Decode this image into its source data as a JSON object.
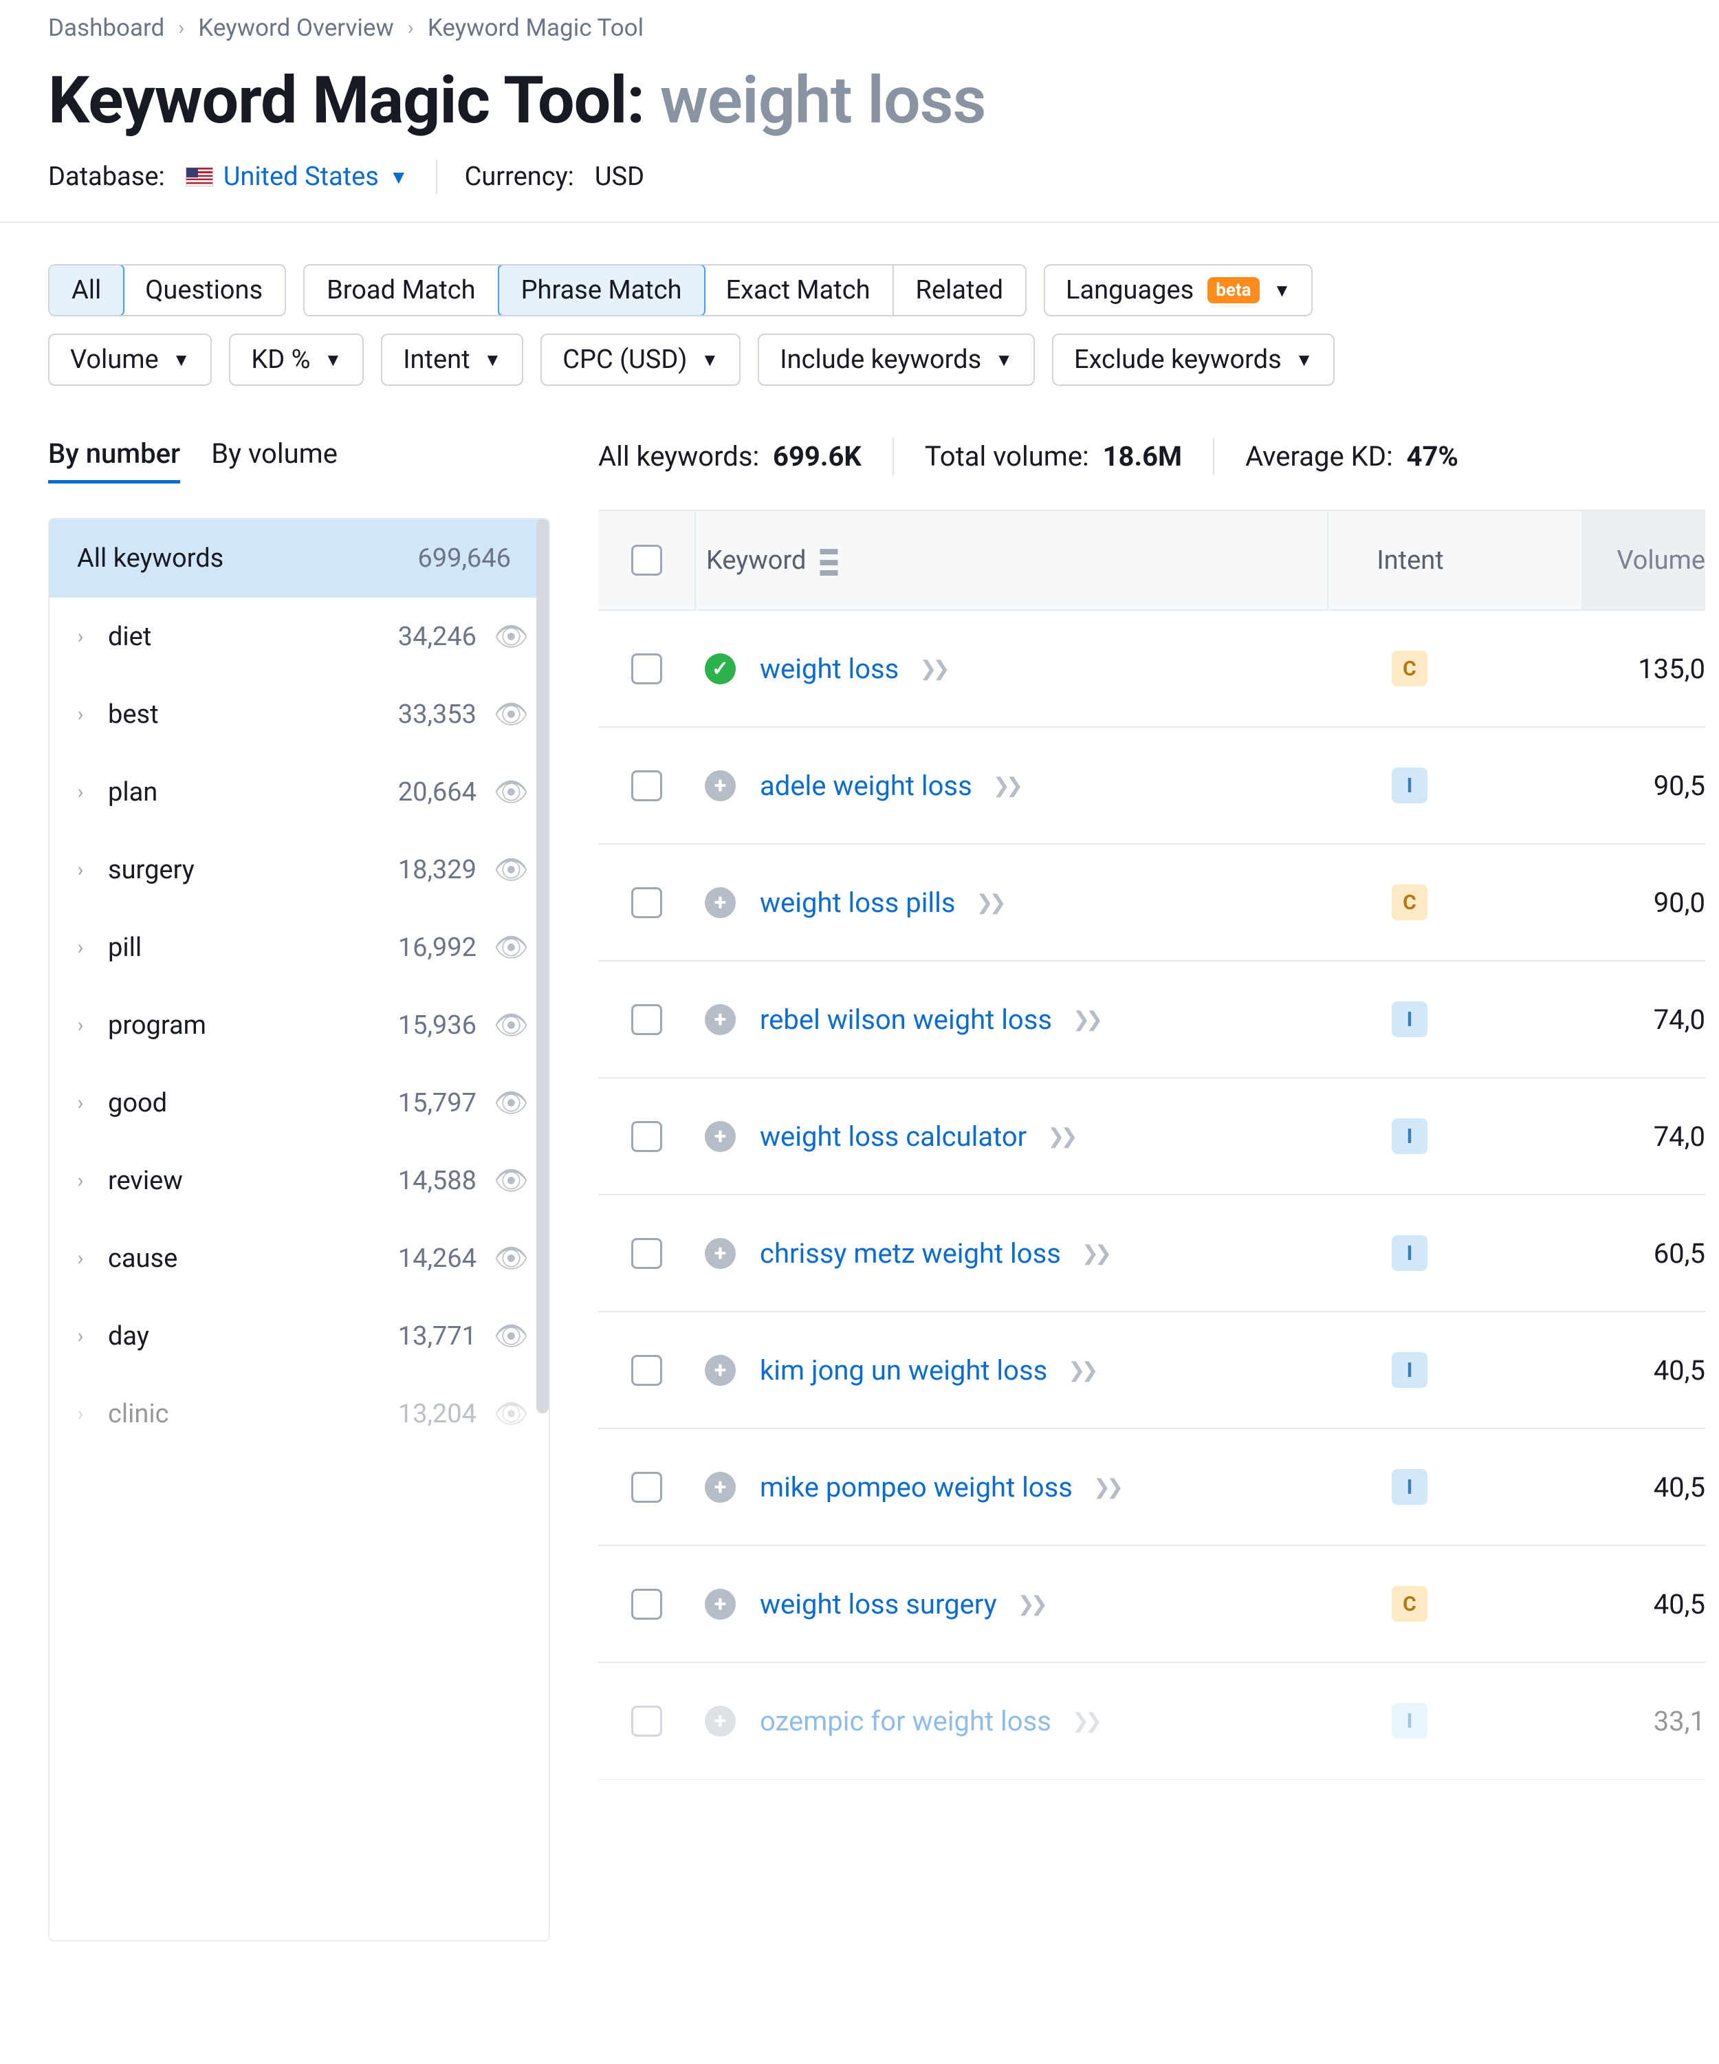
{
  "breadcrumbs": [
    "Dashboard",
    "Keyword Overview",
    "Keyword Magic Tool"
  ],
  "title_prefix": "Keyword Magic Tool:",
  "title_query": "weight loss",
  "database_label": "Database:",
  "database_country": "United States",
  "currency_label": "Currency:",
  "currency_value": "USD",
  "seg1": {
    "items": [
      "All",
      "Questions"
    ],
    "active": "All"
  },
  "seg2": {
    "items": [
      "Broad Match",
      "Phrase Match",
      "Exact Match",
      "Related"
    ],
    "active": "Phrase Match"
  },
  "languages_label": "Languages",
  "beta_label": "beta",
  "filters": [
    "Volume",
    "KD %",
    "Intent",
    "CPC (USD)",
    "Include keywords",
    "Exclude keywords"
  ],
  "left_tabs": {
    "items": [
      "By number",
      "By volume"
    ],
    "active": "By number"
  },
  "left_header": {
    "label": "All keywords",
    "count": "699,646"
  },
  "left_rows": [
    {
      "term": "diet",
      "count": "34,246",
      "dim": false
    },
    {
      "term": "best",
      "count": "33,353",
      "dim": false
    },
    {
      "term": "plan",
      "count": "20,664",
      "dim": false
    },
    {
      "term": "surgery",
      "count": "18,329",
      "dim": false
    },
    {
      "term": "pill",
      "count": "16,992",
      "dim": false
    },
    {
      "term": "program",
      "count": "15,936",
      "dim": false
    },
    {
      "term": "good",
      "count": "15,797",
      "dim": false
    },
    {
      "term": "review",
      "count": "14,588",
      "dim": false
    },
    {
      "term": "cause",
      "count": "14,264",
      "dim": false
    },
    {
      "term": "day",
      "count": "13,771",
      "dim": false
    },
    {
      "term": "clinic",
      "count": "13,204",
      "dim": true
    }
  ],
  "stats": {
    "all_label": "All keywords:",
    "all_value": "699.6K",
    "vol_label": "Total volume:",
    "vol_value": "18.6M",
    "kd_label": "Average KD:",
    "kd_value": "47%"
  },
  "thead": {
    "keyword": "Keyword",
    "intent": "Intent",
    "volume": "Volume"
  },
  "rows": [
    {
      "checked": true,
      "kw": "weight loss",
      "intent": "C",
      "vol": "135,0",
      "dim": false
    },
    {
      "checked": false,
      "kw": "adele weight loss",
      "intent": "I",
      "vol": "90,5",
      "dim": false
    },
    {
      "checked": false,
      "kw": "weight loss pills",
      "intent": "C",
      "vol": "90,0",
      "dim": false
    },
    {
      "checked": false,
      "kw": "rebel wilson weight loss",
      "intent": "I",
      "vol": "74,0",
      "dim": false
    },
    {
      "checked": false,
      "kw": "weight loss calculator",
      "intent": "I",
      "vol": "74,0",
      "dim": false
    },
    {
      "checked": false,
      "kw": "chrissy metz weight loss",
      "intent": "I",
      "vol": "60,5",
      "dim": false
    },
    {
      "checked": false,
      "kw": "kim jong un weight loss",
      "intent": "I",
      "vol": "40,5",
      "dim": false
    },
    {
      "checked": false,
      "kw": "mike pompeo weight loss",
      "intent": "I",
      "vol": "40,5",
      "dim": false
    },
    {
      "checked": false,
      "kw": "weight loss surgery",
      "intent": "C",
      "vol": "40,5",
      "dim": false
    },
    {
      "checked": false,
      "kw": "ozempic for weight loss",
      "intent": "I",
      "vol": "33,1",
      "dim": true
    }
  ]
}
